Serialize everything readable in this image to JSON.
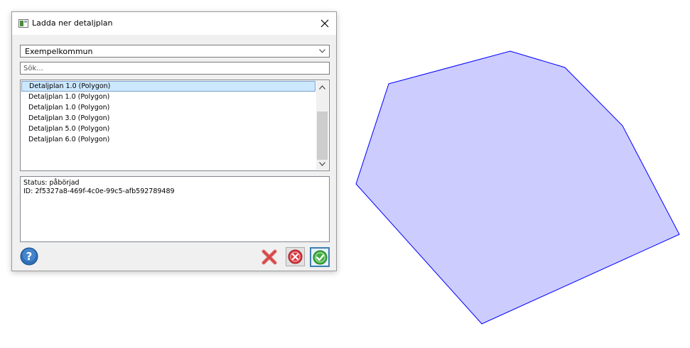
{
  "dialog": {
    "title": "Ladda ner detaljplan",
    "close_icon": "close-icon",
    "app_icon": "window-app-icon"
  },
  "municipality": {
    "selected": "Exempelkommun",
    "icon": "chevron-down-icon"
  },
  "search": {
    "placeholder": "Sök...",
    "value": ""
  },
  "plans": {
    "items": [
      "Detaljplan 1.0 (Polygon)",
      "Detaljplan 1.0 (Polygon)",
      "Detaljplan 1.0 (Polygon)",
      "Detaljplan 3.0 (Polygon)",
      "Detaljplan 5.0 (Polygon)",
      "Detaljplan 6.0 (Polygon)"
    ],
    "selected_index": 0
  },
  "info": {
    "status_line": "Status: påbörjad",
    "id_line": "ID: 2f5327a8-469f-4c0e-99c5-afb592789489"
  },
  "buttons": {
    "help_icon": "help-question-icon",
    "delete_icon": "red-x-icon",
    "cancel_icon": "cancel-circle-icon",
    "ok_icon": "ok-check-icon"
  },
  "map": {
    "polygon_fill": "#ccccff",
    "polygon_stroke": "#0000ff"
  }
}
